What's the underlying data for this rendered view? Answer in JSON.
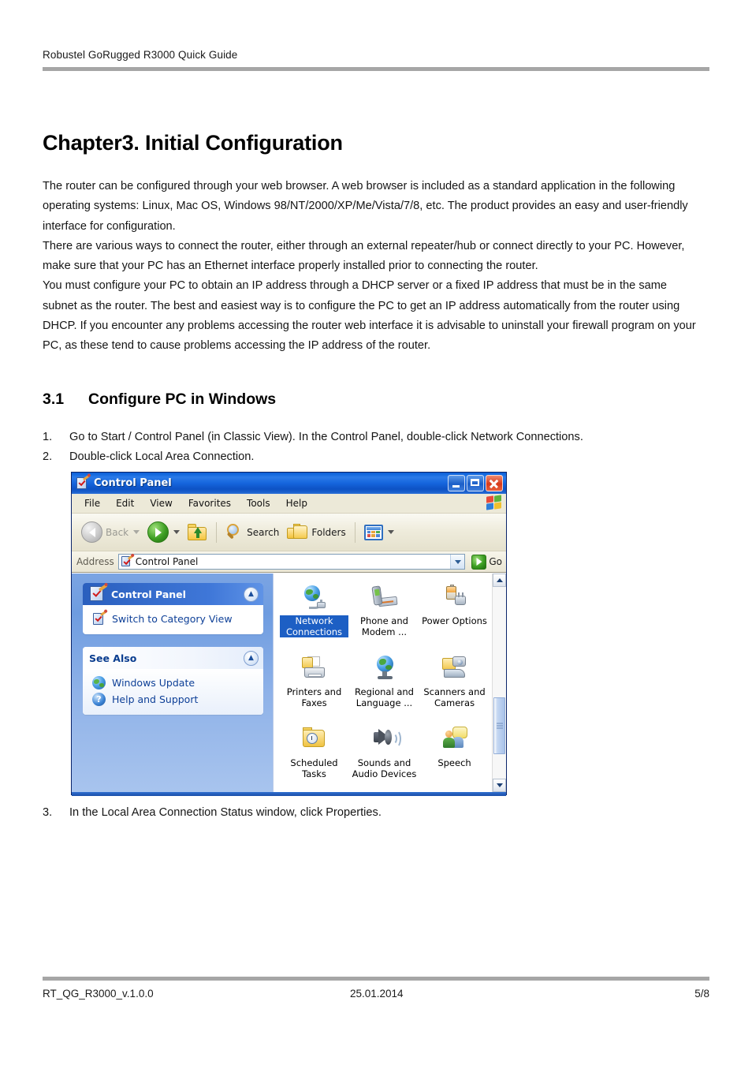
{
  "header": {
    "text": "Robustel GoRugged R3000 Quick Guide"
  },
  "chapter": {
    "title": "Chapter3. Initial Configuration"
  },
  "intro": {
    "paragraph1": "The router can be configured through your web browser. A web browser is included as a standard application in the following operating systems: Linux, Mac OS, Windows 98/NT/2000/XP/Me/Vista/7/8, etc. The product provides an easy and user-friendly interface for configuration.",
    "paragraph2": "There are various ways to connect the router, either through an external repeater/hub or connect directly to your PC. However, make sure that your PC has an Ethernet interface properly installed prior to connecting the router.",
    "paragraph3": "You must configure your PC to obtain an IP address through a DHCP server or a fixed IP address that must be in the same subnet as the router. The best and easiest way is to configure the PC to get an IP address automatically from the router using DHCP. If you encounter any problems accessing the router web interface it is advisable to uninstall your firewall program on your PC, as these tend to cause problems accessing the IP address of the router."
  },
  "section": {
    "number": "3.1",
    "title": "Configure PC in Windows"
  },
  "steps": [
    {
      "num": "1.",
      "text": "Go to Start / Control Panel (in Classic View). In the Control Panel, double-click Network Connections."
    },
    {
      "num": "2.",
      "text": "Double-click Local Area Connection."
    },
    {
      "num": "3.",
      "text": "In the Local Area Connection Status window, click Properties."
    }
  ],
  "control_panel_window": {
    "title": "Control Panel",
    "window_buttons": {
      "minimize": "Minimize",
      "maximize": "Maximize",
      "close": "Close"
    },
    "menu": [
      "File",
      "Edit",
      "View",
      "Favorites",
      "Tools",
      "Help"
    ],
    "toolbar": {
      "back": "Back",
      "forward": "",
      "up": "",
      "search": "Search",
      "folders": "Folders",
      "views": ""
    },
    "address": {
      "label": "Address",
      "value": "Control Panel",
      "go": "Go"
    },
    "task_panes": [
      {
        "title": "Control Panel",
        "style": "blue",
        "items": [
          "Switch to Category View"
        ]
      },
      {
        "title": "See Also",
        "style": "white",
        "items": [
          "Windows Update",
          "Help and Support"
        ]
      }
    ],
    "applets": [
      {
        "label": "Network Connections",
        "icon": "network-connections-icon",
        "selected": true
      },
      {
        "label": "Phone and Modem ...",
        "icon": "phone-and-modem-icon",
        "selected": false
      },
      {
        "label": "Power Options",
        "icon": "power-options-icon",
        "selected": false
      },
      {
        "label": "Printers and Faxes",
        "icon": "printers-and-faxes-icon",
        "selected": false
      },
      {
        "label": "Regional and Language ...",
        "icon": "regional-and-language-icon",
        "selected": false
      },
      {
        "label": "Scanners and Cameras",
        "icon": "scanners-and-cameras-icon",
        "selected": false
      },
      {
        "label": "Scheduled Tasks",
        "icon": "scheduled-tasks-icon",
        "selected": false
      },
      {
        "label": "Sounds and Audio Devices",
        "icon": "sounds-and-audio-devices-icon",
        "selected": false
      },
      {
        "label": "Speech",
        "icon": "speech-icon",
        "selected": false
      }
    ],
    "colors": {
      "titlebar": "#1565dd",
      "selection": "#1d5fc4",
      "sidebar": "#7ba4e3",
      "chrome": "#ece9d8"
    }
  },
  "footer": {
    "document_id": "RT_QG_R3000_v.1.0.0",
    "date": "25.01.2014",
    "page": "5/8"
  }
}
